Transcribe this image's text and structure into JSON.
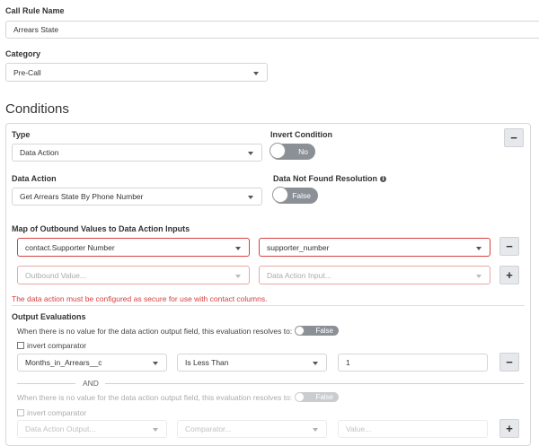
{
  "call_rule_name": {
    "label": "Call Rule Name",
    "value": "Arrears State"
  },
  "category": {
    "label": "Category",
    "value": "Pre-Call"
  },
  "conditions": {
    "heading": "Conditions",
    "type": {
      "label": "Type",
      "value": "Data Action"
    },
    "invert_condition": {
      "label": "Invert Condition",
      "value": "No"
    },
    "data_action": {
      "label": "Data Action",
      "value": "Get Arrears State By Phone Number"
    },
    "data_not_found": {
      "label": "Data Not Found Resolution",
      "value": "False"
    },
    "map": {
      "label": "Map of Outbound Values to Data Action Inputs",
      "rows": [
        {
          "outbound": "contact.Supporter Number",
          "input": "supporter_number"
        }
      ],
      "outbound_placeholder": "Outbound Value...",
      "input_placeholder": "Data Action Input...",
      "error": "The data action must be configured as secure for use with contact columns."
    },
    "output": {
      "label": "Output Evaluations",
      "no_value_text": "When there is no value for the data action output field, this evaluation resolves to:",
      "toggle_value": "False",
      "invert_label": "invert comparator",
      "field": "Months_in_Arrears__c",
      "comparator": "Is Less Than",
      "value": "1",
      "and_label": "AND",
      "field_placeholder": "Data Action Output...",
      "comparator_placeholder": "Comparator...",
      "value_placeholder": "Value..."
    }
  },
  "icons": {
    "minus": "−",
    "plus": "+",
    "info": "i"
  },
  "colors": {
    "error": "#d64040",
    "toggle": "#8b9097"
  }
}
